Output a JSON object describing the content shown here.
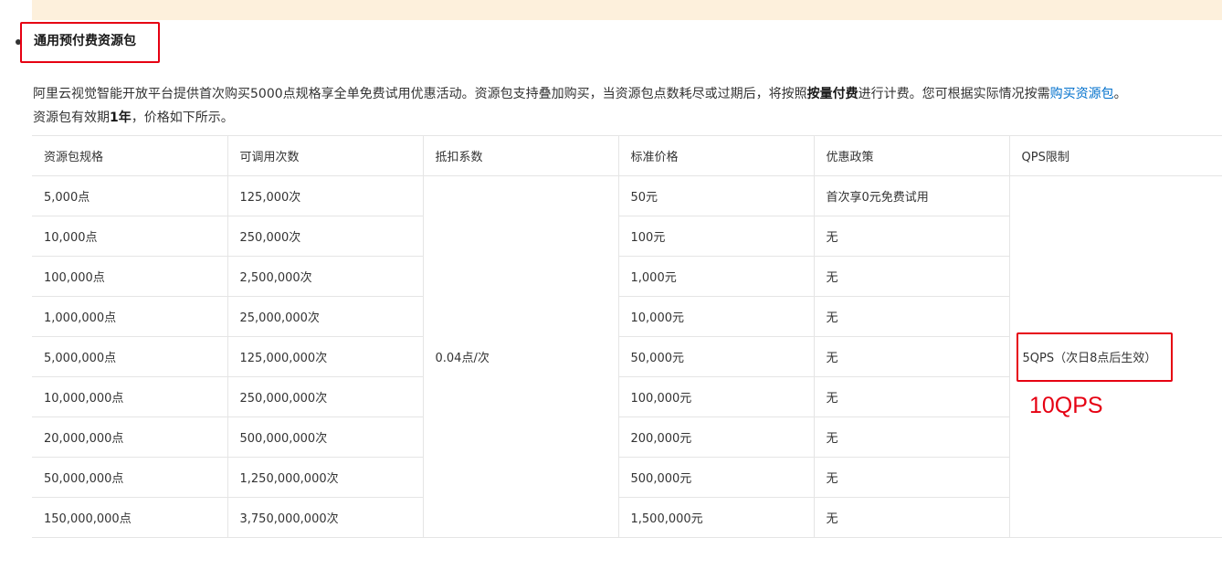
{
  "section": {
    "heading": "通用预付费资源包"
  },
  "description": {
    "part1": "阿里云视觉智能开放平台提供首次购买5000点规格享全单免费试用优惠活动。资源包支持叠加购买，当资源包点数耗尽或过期后，将按照",
    "bold1": "按量付费",
    "part2": "进行计费。您可根据实际情况按需",
    "link": "购买资源包",
    "part3": "。",
    "part4": "资源包有效期",
    "bold2": "1年",
    "part5": "，价格如下所示。"
  },
  "table": {
    "headers": [
      "资源包规格",
      "可调用次数",
      "抵扣系数",
      "标准价格",
      "优惠政策",
      "QPS限制"
    ],
    "deduction": "0.04点/次",
    "qps": "5QPS（次日8点后生效）",
    "rows": [
      {
        "spec": "5,000点",
        "calls": "125,000次",
        "price": "50元",
        "policy": "首次享0元免费试用"
      },
      {
        "spec": "10,000点",
        "calls": "250,000次",
        "price": "100元",
        "policy": "无"
      },
      {
        "spec": "100,000点",
        "calls": "2,500,000次",
        "price": "1,000元",
        "policy": "无"
      },
      {
        "spec": "1,000,000点",
        "calls": "25,000,000次",
        "price": "10,000元",
        "policy": "无"
      },
      {
        "spec": "5,000,000点",
        "calls": "125,000,000次",
        "price": "50,000元",
        "policy": "无"
      },
      {
        "spec": "10,000,000点",
        "calls": "250,000,000次",
        "price": "100,000元",
        "policy": "无"
      },
      {
        "spec": "20,000,000点",
        "calls": "500,000,000次",
        "price": "200,000元",
        "policy": "无"
      },
      {
        "spec": "50,000,000点",
        "calls": "1,250,000,000次",
        "price": "500,000元",
        "policy": "无"
      },
      {
        "spec": "150,000,000点",
        "calls": "3,750,000,000次",
        "price": "1,500,000元",
        "policy": "无"
      }
    ]
  },
  "annotation": {
    "text": "10QPS",
    "color": "#e60012"
  },
  "colors": {
    "notice_bg": "#fdf0dc",
    "link": "#0070cc",
    "highlight": "#e60012",
    "border": "#e5e5e5"
  }
}
